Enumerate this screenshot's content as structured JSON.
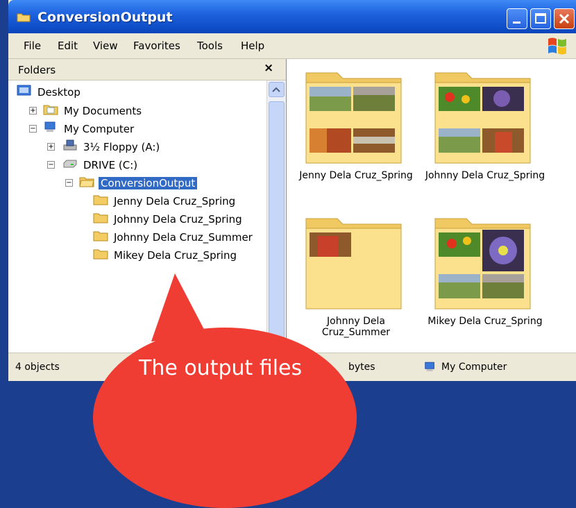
{
  "window": {
    "title": "ConversionOutput"
  },
  "menu": [
    "File",
    "Edit",
    "View",
    "Favorites",
    "Tools",
    "Help"
  ],
  "folders_pane": {
    "title": "Folders",
    "close": "×",
    "tree": {
      "desktop": "Desktop",
      "my_documents": "My Documents",
      "my_computer": "My Computer",
      "floppy": "3½ Floppy (A:)",
      "drive": "DRIVE (C:)",
      "conversion_output": "ConversionOutput",
      "children": [
        "Jenny Dela Cruz_Spring",
        "Johnny Dela Cruz_Spring",
        "Johnny Dela Cruz_Summer",
        "Mikey Dela Cruz_Spring"
      ]
    }
  },
  "files": [
    {
      "label": "Jenny Dela Cruz_Spring"
    },
    {
      "label": "Johnny Dela Cruz_Spring"
    },
    {
      "label": "Johnny Dela Cruz_Summer"
    },
    {
      "label": "Mikey Dela Cruz_Spring"
    }
  ],
  "status": {
    "objects": "4 objects",
    "size": "bytes",
    "location": "My Computer"
  },
  "callout": {
    "text": "The output files",
    "color": "#f03d33"
  },
  "colors": {
    "title_bar": "#1f63df",
    "selection": "#316ac5"
  }
}
